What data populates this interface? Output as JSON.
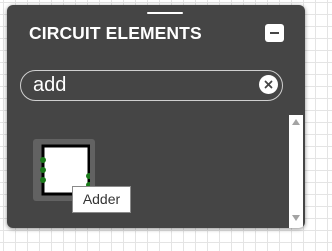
{
  "panel": {
    "title": "CIRCUIT ELEMENTS",
    "minimize_icon": "minus-icon"
  },
  "search": {
    "value": "add",
    "clear_icon": "close-icon"
  },
  "results": [
    {
      "label": "Adder",
      "icon": "adder-icon"
    }
  ],
  "tooltip": {
    "text": "Adder"
  },
  "colors": {
    "panel_background": "#454545",
    "tile_background": "#626262",
    "pin": "#1a7a1a"
  }
}
